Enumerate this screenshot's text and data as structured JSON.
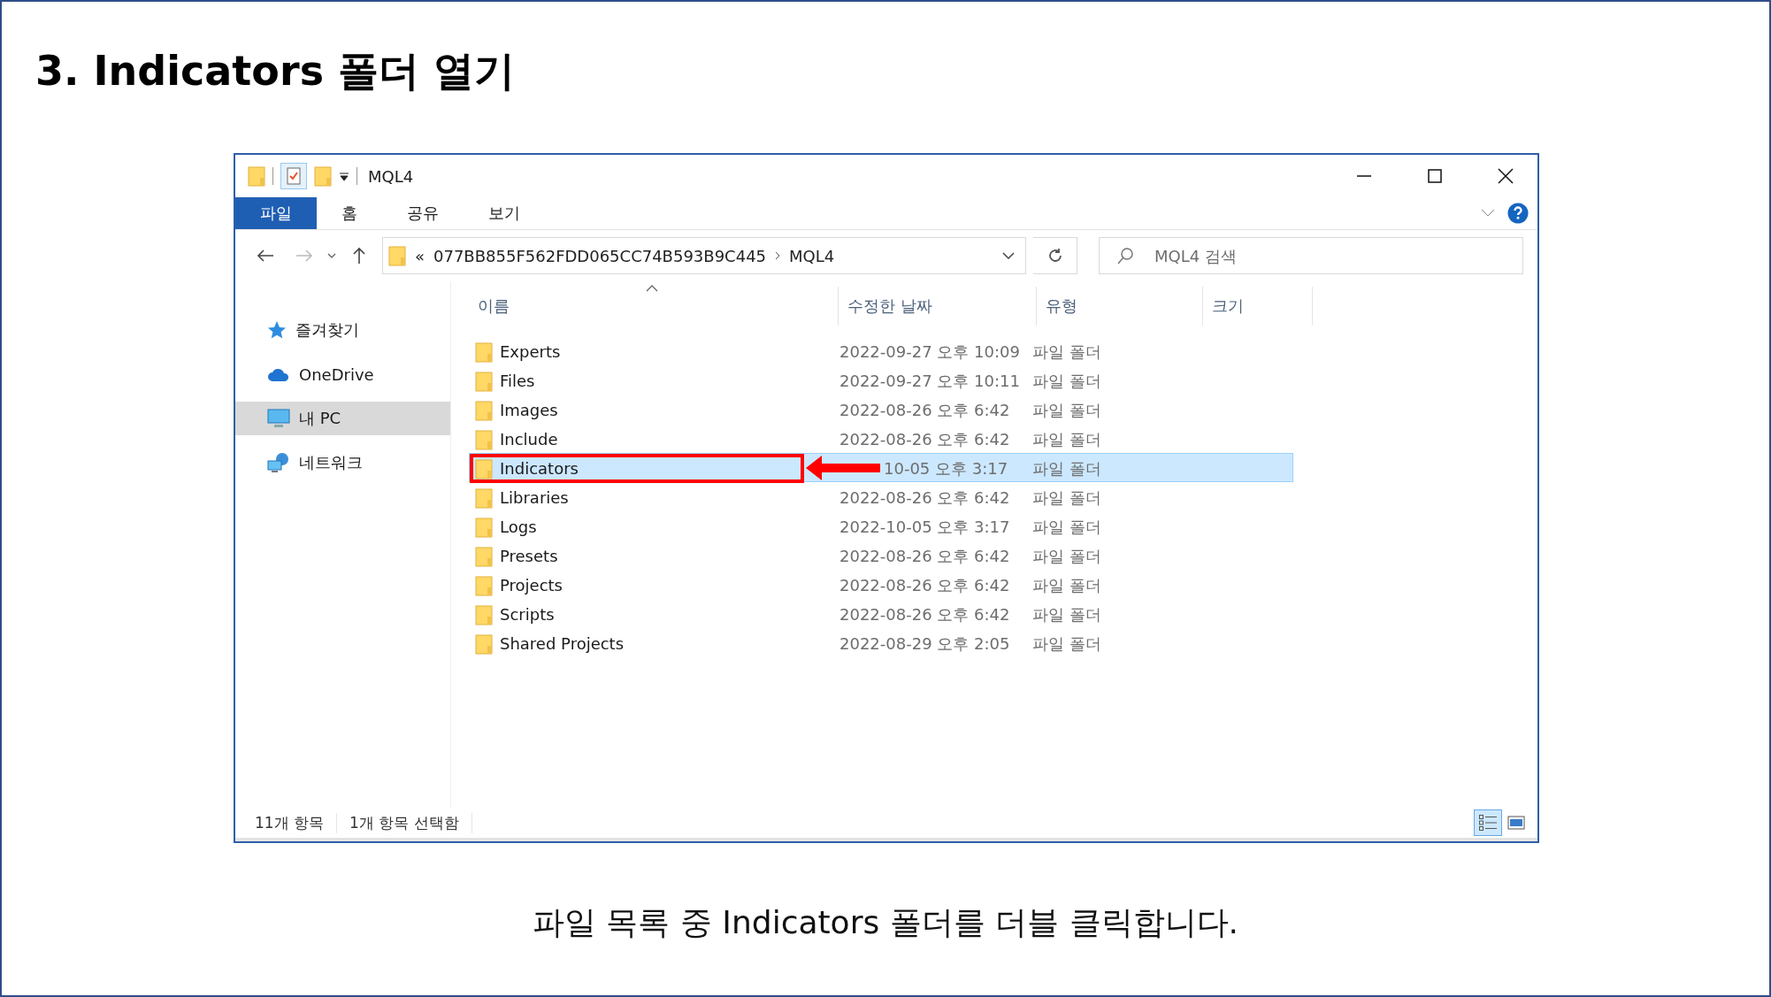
{
  "slide": {
    "title": "3. Indicators 폴더 열기",
    "caption": "파일 목록 중 Indicators 폴더를 더블 클릭합니다."
  },
  "window": {
    "title": "MQL4",
    "ribbon_tabs": [
      {
        "label": "파일",
        "selected": true
      },
      {
        "label": "홈",
        "selected": false
      },
      {
        "label": "공유",
        "selected": false
      },
      {
        "label": "보기",
        "selected": false
      }
    ],
    "address": {
      "overflow_mark": "«",
      "path": [
        "077BB855F562FDD065CC74B593B9C445",
        "MQL4"
      ]
    },
    "search": {
      "placeholder": "MQL4 검색"
    }
  },
  "sidebar": {
    "items": [
      {
        "label": "즐겨찾기",
        "kind": "star",
        "selected": false
      },
      {
        "label": "OneDrive",
        "kind": "cloud",
        "selected": false
      },
      {
        "label": "내 PC",
        "kind": "pc",
        "selected": true
      },
      {
        "label": "네트워크",
        "kind": "network",
        "selected": false
      }
    ]
  },
  "table": {
    "columns": [
      "이름",
      "수정한 날짜",
      "유형",
      "크기"
    ],
    "rows": [
      {
        "name": "Experts",
        "modified": "2022-09-27 오후 10:09",
        "type": "파일 폴더",
        "selected": false,
        "highlighted": false
      },
      {
        "name": "Files",
        "modified": "2022-09-27 오후 10:11",
        "type": "파일 폴더",
        "selected": false,
        "highlighted": false
      },
      {
        "name": "Images",
        "modified": "2022-08-26 오후 6:42",
        "type": "파일 폴더",
        "selected": false,
        "highlighted": false
      },
      {
        "name": "Include",
        "modified": "2022-08-26 오후 6:42",
        "type": "파일 폴더",
        "selected": false,
        "highlighted": false
      },
      {
        "name": "Indicators",
        "modified": "10-05 오후 3:17",
        "type": "파일 폴더",
        "selected": true,
        "highlighted": true
      },
      {
        "name": "Libraries",
        "modified": "2022-08-26 오후 6:42",
        "type": "파일 폴더",
        "selected": false,
        "highlighted": false
      },
      {
        "name": "Logs",
        "modified": "2022-10-05 오후 3:17",
        "type": "파일 폴더",
        "selected": false,
        "highlighted": false
      },
      {
        "name": "Presets",
        "modified": "2022-08-26 오후 6:42",
        "type": "파일 폴더",
        "selected": false,
        "highlighted": false
      },
      {
        "name": "Projects",
        "modified": "2022-08-26 오후 6:42",
        "type": "파일 폴더",
        "selected": false,
        "highlighted": false
      },
      {
        "name": "Scripts",
        "modified": "2022-08-26 오후 6:42",
        "type": "파일 폴더",
        "selected": false,
        "highlighted": false
      },
      {
        "name": "Shared Projects",
        "modified": "2022-08-29 오후 2:05",
        "type": "파일 폴더",
        "selected": false,
        "highlighted": false
      }
    ]
  },
  "status_bar": {
    "count": "11개 항목",
    "selection": "1개 항목 선택함",
    "view_buttons": [
      {
        "kind": "details",
        "selected": true
      },
      {
        "kind": "large",
        "selected": false
      }
    ]
  }
}
